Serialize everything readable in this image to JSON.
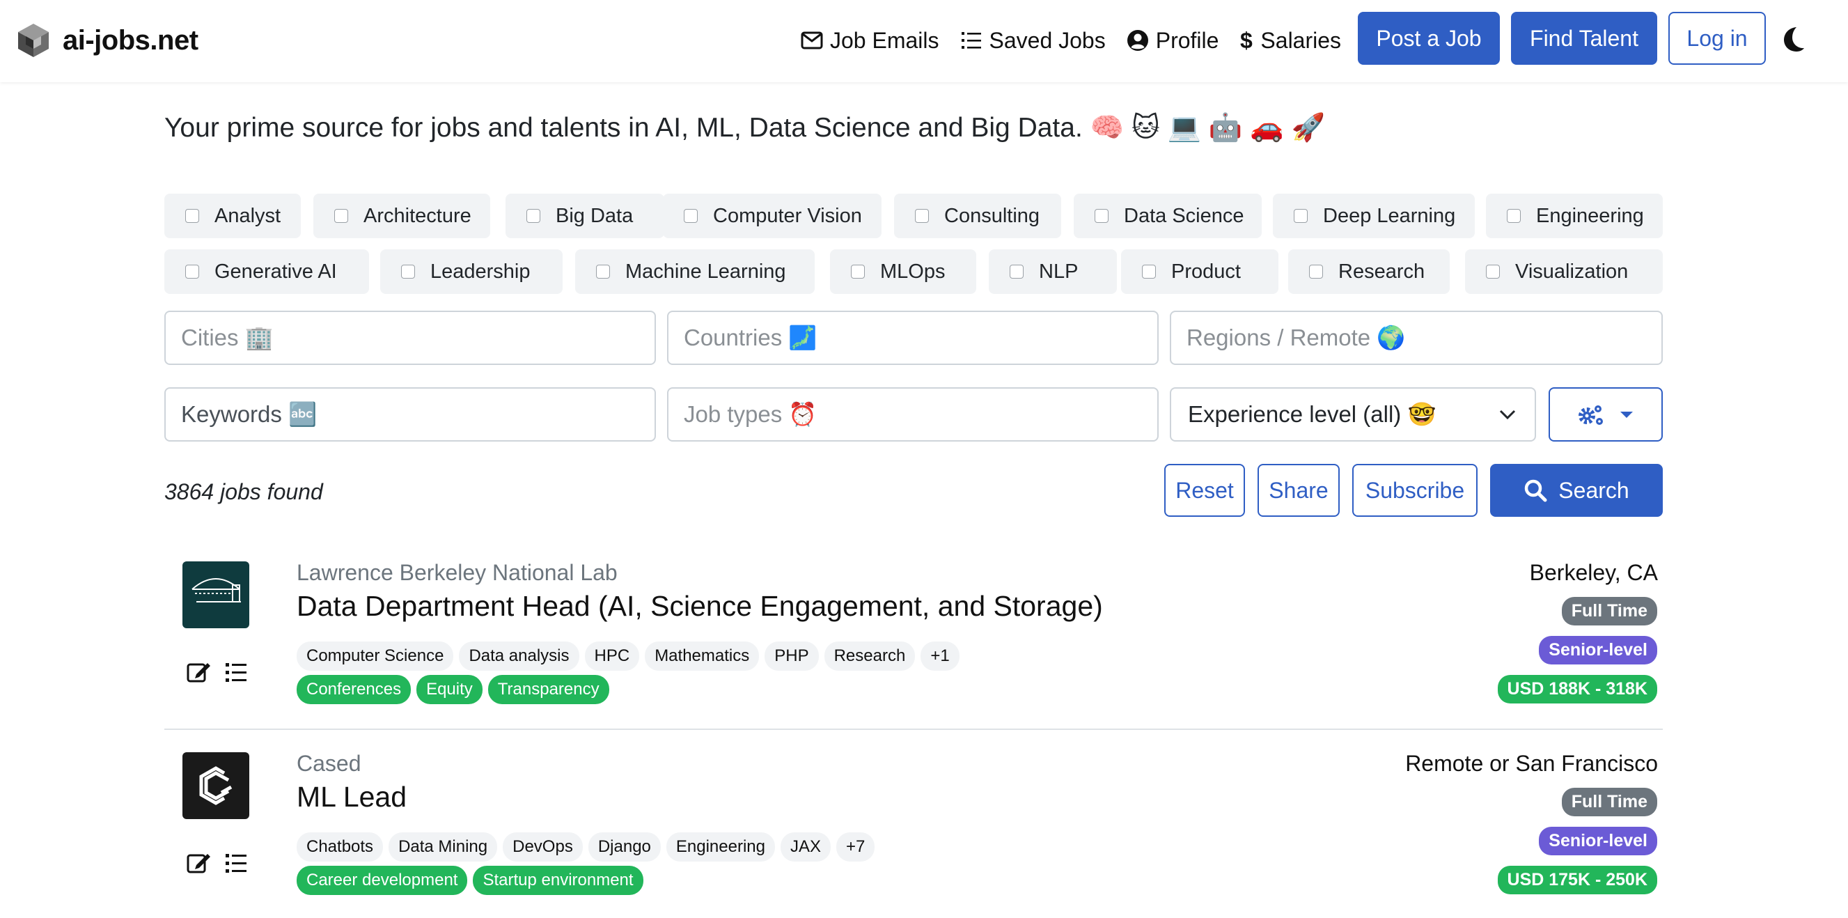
{
  "navbar": {
    "brand": "ai-jobs.net",
    "links": [
      {
        "label": "Job Emails",
        "icon": "envelope-icon"
      },
      {
        "label": "Saved Jobs",
        "icon": "list-icon"
      },
      {
        "label": "Profile",
        "icon": "user-circle-icon"
      },
      {
        "label": "Salaries",
        "icon": "dollar-icon"
      }
    ],
    "post_job": "Post a Job",
    "find_talent": "Find Talent",
    "login": "Log in",
    "theme_icon": "moon-icon"
  },
  "tagline": "Your prime source for jobs and talents in AI, ML, Data Science and Big Data. 🧠 🐱 💻 🤖 🚗 🚀",
  "categories_row1": [
    "Analyst",
    "Architecture",
    "Big Data",
    "Computer Vision",
    "Consulting",
    "Data Science",
    "Deep Learning",
    "Engineering"
  ],
  "categories_row2": [
    "Generative AI",
    "Leadership",
    "Machine Learning",
    "MLOps",
    "NLP",
    "Product",
    "Research",
    "Visualization"
  ],
  "filters": {
    "cities_placeholder": "Cities 🏢",
    "countries_placeholder": "Countries 🗾",
    "regions_placeholder": "Regions / Remote 🌍",
    "keywords_placeholder": "Keywords 🔤",
    "job_types_placeholder": "Job types ⏰",
    "experience_selected": "Experience level (all) 🤓"
  },
  "results": {
    "count_text": "3864 jobs found",
    "reset": "Reset",
    "share": "Share",
    "subscribe": "Subscribe",
    "search": "Search"
  },
  "jobs": [
    {
      "company": "Lawrence Berkeley National Lab",
      "title": "Data Department Head (AI, Science Engagement, and Storage)",
      "tags": [
        "Computer Science",
        "Data analysis",
        "HPC",
        "Mathematics",
        "PHP",
        "Research",
        "+1"
      ],
      "perks": [
        "Conferences",
        "Equity",
        "Transparency"
      ],
      "location": "Berkeley, CA",
      "type": "Full Time",
      "level": "Senior-level",
      "salary": "USD 188K - 318K"
    },
    {
      "company": "Cased",
      "title": "ML Lead",
      "tags": [
        "Chatbots",
        "Data Mining",
        "DevOps",
        "Django",
        "Engineering",
        "JAX",
        "+7"
      ],
      "perks": [
        "Career development",
        "Startup environment"
      ],
      "location": "Remote or San Francisco",
      "type": "Full Time",
      "level": "Senior-level",
      "salary": "USD 175K - 250K"
    }
  ],
  "colors": {
    "primary": "#2f5ec4",
    "perk_green": "#22b65a",
    "level_purple": "#6b5bd6",
    "type_grey": "#6c757d",
    "lbnl_logo_bg": "#0f3b3e",
    "cased_logo_bg": "#1a1a1a"
  }
}
